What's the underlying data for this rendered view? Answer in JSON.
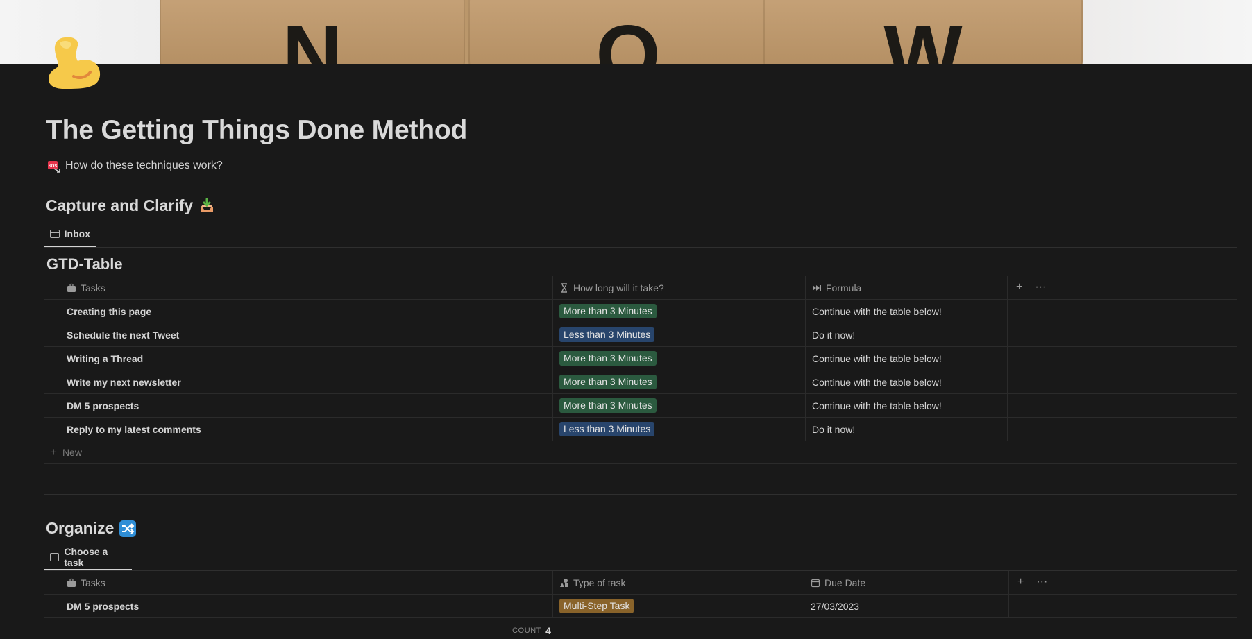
{
  "cover": {
    "letters": [
      "N",
      "O",
      "W"
    ]
  },
  "page": {
    "icon": "flexed-biceps-icon",
    "title": "The Getting Things Done Method",
    "link_text": "How do these techniques work?",
    "link_icon": "sos-icon"
  },
  "section1": {
    "heading": "Capture and Clarify",
    "heading_icon": "inbox-tray-icon",
    "tab_label": "Inbox",
    "db_title": "GTD-Table",
    "columns": [
      "Tasks",
      "How long will it take?",
      "Formula"
    ],
    "column_icons": [
      "briefcase-icon",
      "hourglass-icon",
      "fast-forward-icon"
    ],
    "rows": [
      {
        "task": "Creating this page",
        "duration": "More than 3 Minutes",
        "duration_color": "green",
        "formula": "Continue with the table below!"
      },
      {
        "task": "Schedule the next Tweet",
        "duration": "Less than 3 Minutes",
        "duration_color": "blue",
        "formula": "Do it now!"
      },
      {
        "task": "Writing a Thread",
        "duration": "More than 3 Minutes",
        "duration_color": "green",
        "formula": "Continue with the table below!"
      },
      {
        "task": "Write my next newsletter",
        "duration": "More than 3 Minutes",
        "duration_color": "green",
        "formula": "Continue with the table below!"
      },
      {
        "task": "DM 5 prospects",
        "duration": "More than 3 Minutes",
        "duration_color": "green",
        "formula": "Continue with the table below!"
      },
      {
        "task": "Reply to my latest comments",
        "duration": "Less than 3 Minutes",
        "duration_color": "blue",
        "formula": "Do it now!"
      }
    ],
    "new_label": "New"
  },
  "section2": {
    "heading": "Organize",
    "heading_icon": "shuffle-icon",
    "tab_label": "Choose a task",
    "columns": [
      "Tasks",
      "Type of task",
      "Due Date"
    ],
    "column_icons": [
      "briefcase-icon",
      "shapes-icon",
      "calendar-icon"
    ],
    "rows": [
      {
        "task": "DM 5 prospects",
        "type": "Multi-Step Task",
        "type_color": "brown",
        "due": "27/03/2023"
      }
    ],
    "count_label": "COUNT",
    "count_value": "4"
  },
  "colors": {
    "background": "#191919",
    "green_tag": "#2b5a3f",
    "blue_tag": "#28456c",
    "brown_tag": "#89632a"
  }
}
